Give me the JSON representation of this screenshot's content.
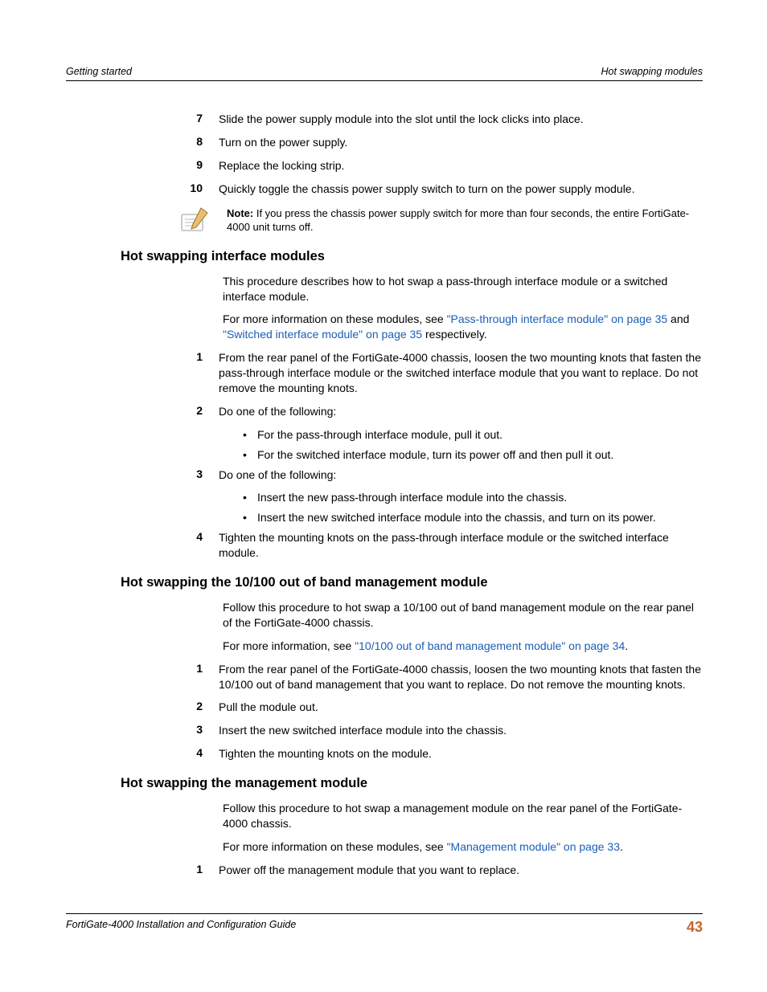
{
  "header": {
    "left": "Getting started",
    "right": "Hot swapping modules"
  },
  "topList": {
    "7": "Slide the power supply module into the slot until the lock clicks into place.",
    "8": "Turn on the power supply.",
    "9": "Replace the locking strip.",
    "10": "Quickly toggle the chassis power supply switch to turn on the power supply module."
  },
  "note": {
    "label": "Note:",
    "text": " If you press the chassis power supply switch for more than four seconds, the entire FortiGate-4000 unit turns off."
  },
  "section1": {
    "heading": "Hot swapping interface modules",
    "p1": "This procedure describes how to hot swap a pass-through interface module or a switched interface module.",
    "p2_a": "For more information on these modules, see ",
    "p2_link1": "\"Pass-through interface module\" on page 35",
    "p2_b": " and ",
    "p2_link2": "\"Switched interface module\" on page 35",
    "p2_c": " respectively.",
    "step1": "From the rear panel of the FortiGate-4000 chassis, loosen the two mounting knots that fasten the pass-through interface module or the switched interface module that you want to replace. Do not remove the mounting knots.",
    "step2": "Do one of the following:",
    "b2a": "For the pass-through interface module, pull it out.",
    "b2b": "For the switched interface module, turn its power off and then pull it out.",
    "step3": "Do one of the following:",
    "b3a": "Insert the new pass-through interface module into the chassis.",
    "b3b": "Insert the new switched interface module into the chassis, and turn on its power.",
    "step4": "Tighten the mounting knots on the pass-through interface module or the switched interface module."
  },
  "section2": {
    "heading": "Hot swapping the 10/100 out of band management module",
    "p1": "Follow this procedure to hot swap a 10/100 out of band management module on the rear panel of the FortiGate-4000 chassis.",
    "p2_a": "For more information, see ",
    "p2_link": "\"10/100 out of band management module\" on page 34",
    "p2_b": ".",
    "step1": "From the rear panel of the FortiGate-4000 chassis, loosen the two mounting knots that fasten the 10/100 out of band management that you want to replace. Do not remove the mounting knots.",
    "step2": "Pull the module out.",
    "step3": "Insert the new switched interface module into the chassis.",
    "step4": "Tighten the mounting knots on the module."
  },
  "section3": {
    "heading": "Hot swapping the management module",
    "p1": "Follow this procedure to hot swap a management module on the rear panel of the FortiGate-4000 chassis.",
    "p2_a": "For more information on these modules, see ",
    "p2_link": "\"Management module\" on page 33",
    "p2_b": ".",
    "step1": "Power off the management module that you want to replace."
  },
  "footer": {
    "left": "FortiGate-4000 Installation and Configuration Guide",
    "pagenum": "43"
  },
  "nums": {
    "n1": "1",
    "n2": "2",
    "n3": "3",
    "n4": "4",
    "n7": "7",
    "n8": "8",
    "n9": "9",
    "n10": "10"
  }
}
